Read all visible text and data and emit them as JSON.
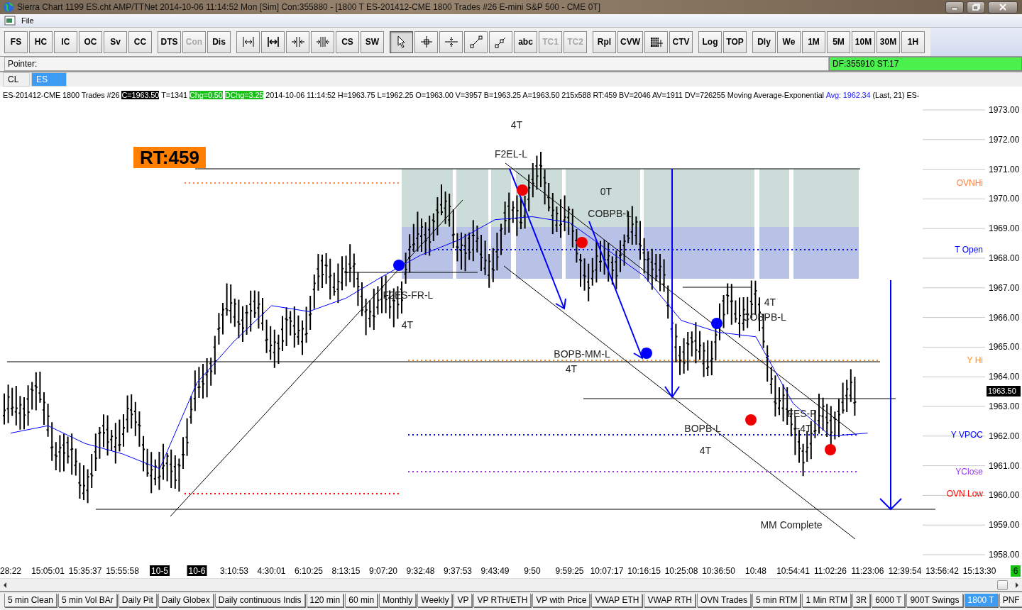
{
  "window": {
    "title": "Sierra Chart 1199 ES.cht  AMP/TTNet 2014-10-06  11:14:52 Mon [Sim]  Con:355880 - [1800 T  ES-201412-CME  1800 Trades  #26  E-mini S&P 500 - CME  0T]"
  },
  "menu": [
    "File"
  ],
  "toolbar": [
    {
      "items": [
        {
          "kind": "text",
          "label": "FS",
          "disabled": false,
          "pressed": false
        },
        {
          "kind": "text",
          "label": "HC",
          "disabled": false,
          "pressed": false
        },
        {
          "kind": "text",
          "label": "IC",
          "disabled": false,
          "pressed": false
        },
        {
          "kind": "text",
          "label": "OC",
          "disabled": false,
          "pressed": false
        },
        {
          "kind": "text",
          "label": "Sv",
          "disabled": false,
          "pressed": false
        },
        {
          "kind": "text",
          "label": "CC",
          "disabled": false,
          "pressed": false
        }
      ]
    },
    {
      "items": [
        {
          "kind": "text",
          "label": "DTS",
          "disabled": false,
          "pressed": false
        },
        {
          "kind": "text",
          "label": "Con",
          "disabled": true,
          "pressed": false
        },
        {
          "kind": "text",
          "label": "Dis",
          "disabled": false,
          "pressed": false
        }
      ]
    },
    {
      "items": [
        {
          "kind": "icon",
          "disabled": false,
          "pressed": false
        },
        {
          "kind": "icon",
          "disabled": false,
          "pressed": false
        },
        {
          "kind": "icon",
          "disabled": false,
          "pressed": false
        },
        {
          "kind": "icon",
          "disabled": false,
          "pressed": false
        },
        {
          "kind": "text",
          "label": "CS",
          "disabled": false,
          "pressed": false
        },
        {
          "kind": "text",
          "label": "SW",
          "disabled": false,
          "pressed": false
        }
      ]
    },
    {
      "items": [
        {
          "kind": "icon",
          "disabled": false,
          "pressed": true
        },
        {
          "kind": "icon",
          "disabled": false,
          "pressed": false
        },
        {
          "kind": "icon",
          "disabled": false,
          "pressed": false
        },
        {
          "kind": "icon",
          "disabled": false,
          "pressed": false
        },
        {
          "kind": "icon",
          "disabled": false,
          "pressed": false
        },
        {
          "kind": "text",
          "label": "abc",
          "disabled": false,
          "pressed": false
        },
        {
          "kind": "text",
          "label": "TC1",
          "disabled": true,
          "pressed": false
        },
        {
          "kind": "text",
          "label": "TC2",
          "disabled": true,
          "pressed": false
        }
      ]
    },
    {
      "items": [
        {
          "kind": "text",
          "label": "Rpl",
          "disabled": false,
          "pressed": false
        },
        {
          "kind": "text",
          "label": "CVW",
          "disabled": false,
          "pressed": false
        },
        {
          "kind": "icon",
          "disabled": false,
          "pressed": false
        },
        {
          "kind": "text",
          "label": "CTV",
          "disabled": false,
          "pressed": false
        }
      ]
    },
    {
      "items": [
        {
          "kind": "text",
          "label": "Log",
          "disabled": false,
          "pressed": false
        },
        {
          "kind": "text",
          "label": "TOP",
          "disabled": false,
          "pressed": false
        }
      ]
    },
    {
      "items": [
        {
          "kind": "text",
          "label": "Dly",
          "disabled": false,
          "pressed": false
        },
        {
          "kind": "text",
          "label": "We",
          "disabled": false,
          "pressed": false
        },
        {
          "kind": "text",
          "label": "1M",
          "disabled": false,
          "pressed": false
        },
        {
          "kind": "text",
          "label": "5M",
          "disabled": false,
          "pressed": false
        },
        {
          "kind": "text",
          "label": "10M",
          "disabled": false,
          "pressed": false
        },
        {
          "kind": "text",
          "label": "30M",
          "disabled": false,
          "pressed": false
        },
        {
          "kind": "text",
          "label": "1H",
          "disabled": false,
          "pressed": false
        }
      ]
    }
  ],
  "status": {
    "pointer": "Pointer:",
    "feed": "DF:355910  ST:17"
  },
  "chart_tabs": [
    {
      "label": "CL",
      "selected": false
    },
    {
      "label": "ES",
      "selected": true
    }
  ],
  "info_line": [
    {
      "text": "ES-201412-CME  1800 Trades  #26",
      "kind": "plain"
    },
    {
      "text": "C=1963.50",
      "kind": "dark"
    },
    {
      "text": "T=1341",
      "kind": "plain"
    },
    {
      "text": "Chg=0.50",
      "kind": "green"
    },
    {
      "text": "DChg=3.25",
      "kind": "green"
    },
    {
      "text": "2014-10-06 11:14:52 H=1963.75 L=1962.25 O=1963.00 V=3957 B=1963.25 A=1963.50 215x588 RT:459 BV=2046 AV=1911 DV=726255",
      "kind": "plain"
    },
    {
      "kind": "series-name"
    },
    {
      "text": "Avg: 1962.34",
      "kind": "blue"
    },
    {
      "text": "(Last, 21)  ES-",
      "kind": "plain"
    }
  ],
  "chart": {
    "chart_data": {
      "type": "line",
      "categories": [
        "28:22",
        "15:05:01",
        "15:35:37",
        "15:55:58",
        "10-5",
        "10-6",
        "3:10:53",
        "4:30:01",
        "6:10:25",
        "8:13:15",
        "9:07:20",
        "9:32:48",
        "9:37:53",
        "9:43:49",
        "9:50",
        "9:59:25",
        "10:07:17",
        "10:16:15",
        "10:25:08",
        "10:36:50",
        "10:48",
        "10:54:41",
        "11:02:26",
        "11:23:06",
        "12:39:54",
        "13:56:42",
        "15:13:30"
      ],
      "ylim": [
        1958,
        1973
      ],
      "yticks": [
        {
          "value": 1973,
          "label": "1973.00"
        },
        {
          "value": 1972,
          "label": "1972.00"
        },
        {
          "value": 1971,
          "label": "1971.00"
        },
        {
          "value": 1970,
          "label": "1970.00"
        },
        {
          "value": 1969,
          "label": "1969.00"
        },
        {
          "value": 1968,
          "label": "1968.00"
        },
        {
          "value": 1967,
          "label": "1967.00"
        },
        {
          "value": 1966,
          "label": "1966.00"
        },
        {
          "value": 1965,
          "label": "1965.00"
        },
        {
          "value": 1964,
          "label": "1964.00"
        },
        {
          "value": 1963,
          "label": "1963.00"
        },
        {
          "value": 1962,
          "label": "1962.00"
        },
        {
          "value": 1961,
          "label": "1961.00"
        },
        {
          "value": 1960,
          "label": "1960.00"
        },
        {
          "value": 1959,
          "label": "1959.00"
        },
        {
          "value": 1958,
          "label": "1958.00"
        }
      ],
      "series": [
        {
          "name": "Moving Average-Exponential",
          "color": "#0000ff",
          "values": [
            1962.1,
            1962.35,
            1961.75,
            1961.4,
            1960.9,
            1963.8,
            1965.2,
            1966.4,
            1966.2,
            1966.65,
            1967.4,
            1968.1,
            1968.6,
            1969.3,
            1969.4,
            1969.2,
            1968.3,
            1967.4,
            1965.9,
            1965.5,
            1965.35,
            1963.1,
            1962.0,
            1962.1,
            null,
            null,
            null
          ]
        }
      ]
    },
    "category_is_date": [
      false,
      false,
      false,
      false,
      true,
      true,
      false,
      false,
      false,
      false,
      false,
      false,
      false,
      false,
      false,
      false,
      false,
      false,
      false,
      false,
      false,
      false,
      false,
      false,
      false,
      false,
      false
    ],
    "labels": [
      {
        "text": "RT:459",
        "kind": "badge"
      },
      {
        "text": "4T",
        "kind": "label"
      },
      {
        "text": "F2EL-L",
        "kind": "label"
      },
      {
        "text": "0T",
        "kind": "label"
      },
      {
        "text": "COBPB-L",
        "kind": "label"
      },
      {
        "text": "F2ES-FR-L",
        "kind": "label"
      },
      {
        "text": "4T",
        "kind": "label"
      },
      {
        "text": "BOPB-MM-L",
        "kind": "label"
      },
      {
        "text": "4T",
        "kind": "label"
      },
      {
        "text": "4T",
        "kind": "label"
      },
      {
        "text": "COBPB-L",
        "kind": "label"
      },
      {
        "text": "FES-P",
        "kind": "label"
      },
      {
        "text": "-4T",
        "kind": "label"
      },
      {
        "text": "BOPB-L",
        "kind": "label"
      },
      {
        "text": "4T",
        "kind": "label"
      },
      {
        "text": "MM Complete",
        "kind": "label"
      },
      {
        "text": "1963.50",
        "kind": "price-tag"
      }
    ],
    "levels": [
      {
        "label": "OVNHi",
        "color": "#ff8040"
      },
      {
        "label": "T Open",
        "color": "#0000ff"
      },
      {
        "label": "Y Hi",
        "color": "#ff9020"
      },
      {
        "label": "Y VPOC",
        "color": "#0000ff"
      },
      {
        "label": "YClose",
        "color": "#9933ff"
      },
      {
        "label": "OVN Low",
        "color": "#ff0000"
      }
    ],
    "corner_badge": "6"
  },
  "bottom_tabs": [
    {
      "label": "5 min Clean",
      "selected": false
    },
    {
      "label": "5 min Vol BAr",
      "selected": false
    },
    {
      "label": "Daily Pit",
      "selected": false
    },
    {
      "label": "Daily Globex",
      "selected": false
    },
    {
      "label": "Daily continuous Indis",
      "selected": false
    },
    {
      "label": "120 min",
      "selected": false
    },
    {
      "label": "60 min",
      "selected": false
    },
    {
      "label": "Monthly",
      "selected": false
    },
    {
      "label": "Weekly",
      "selected": false
    },
    {
      "label": "VP",
      "selected": false
    },
    {
      "label": "VP RTH/ETH",
      "selected": false
    },
    {
      "label": "VP with Price",
      "selected": false
    },
    {
      "label": "VWAP ETH",
      "selected": false
    },
    {
      "label": "VWAP RTH",
      "selected": false
    },
    {
      "label": "OVN Trades",
      "selected": false
    },
    {
      "label": "5 min RTM",
      "selected": false
    },
    {
      "label": "1 Min RTM",
      "selected": false
    },
    {
      "label": "3R",
      "selected": false
    },
    {
      "label": "6000 T",
      "selected": false
    },
    {
      "label": "900T Swings",
      "selected": false
    },
    {
      "label": "1800 T",
      "selected": true
    },
    {
      "label": "PNF",
      "selected": false
    }
  ]
}
